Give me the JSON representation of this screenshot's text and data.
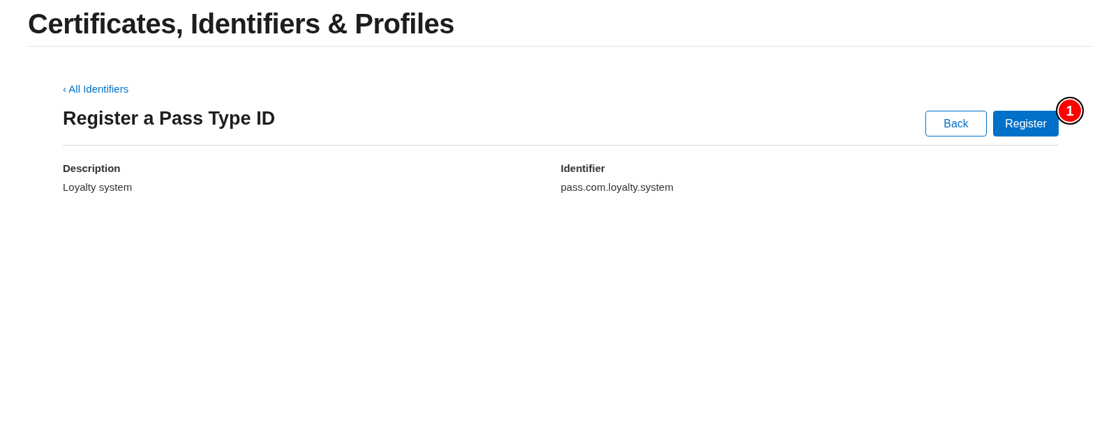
{
  "page_title": "Certificates, Identifiers & Profiles",
  "back_link": {
    "label": "All Identifiers",
    "chevron": "‹"
  },
  "heading": "Register a Pass Type ID",
  "buttons": [
    {
      "label": "Back",
      "kind": "secondary"
    },
    {
      "label": "Register",
      "kind": "primary"
    }
  ],
  "callout": {
    "label": "1"
  },
  "fields": [
    {
      "label": "Description",
      "value": "Loyalty system"
    },
    {
      "label": "Identifier",
      "value": "pass.com.loyalty.system"
    }
  ]
}
